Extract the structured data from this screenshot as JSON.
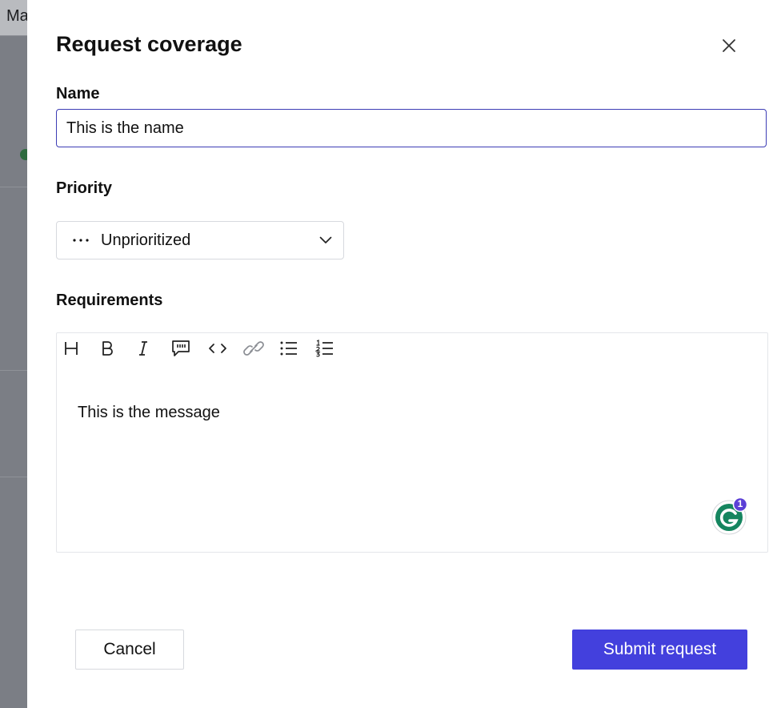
{
  "background": {
    "title_fragment": "Ma"
  },
  "drawer": {
    "title": "Request coverage",
    "close_icon": "close-icon"
  },
  "form": {
    "name_label": "Name",
    "name_value": "This is the name",
    "priority_label": "Priority",
    "priority_value": "Unprioritized",
    "priority_icon": "ellipsis-icon",
    "requirements_label": "Requirements",
    "requirements_value": "This is the message",
    "toolbar": [
      {
        "name": "heading",
        "icon": "heading-icon"
      },
      {
        "name": "bold",
        "icon": "bold-icon"
      },
      {
        "name": "italic",
        "icon": "italic-icon"
      },
      {
        "name": "quote",
        "icon": "quote-icon"
      },
      {
        "name": "code",
        "icon": "code-icon"
      },
      {
        "name": "link",
        "icon": "link-icon"
      },
      {
        "name": "bullet-list",
        "icon": "bullet-list-icon"
      },
      {
        "name": "numbered-list",
        "icon": "numbered-list-icon"
      }
    ],
    "grammarly_badge": "1"
  },
  "actions": {
    "cancel_label": "Cancel",
    "submit_label": "Submit request"
  },
  "colors": {
    "primary": "#4340dd",
    "focus_border": "#3d3db5",
    "grammarly_green": "#15855f",
    "grammarly_badge": "#5b3fd6",
    "backdrop": "#7b7e85"
  }
}
